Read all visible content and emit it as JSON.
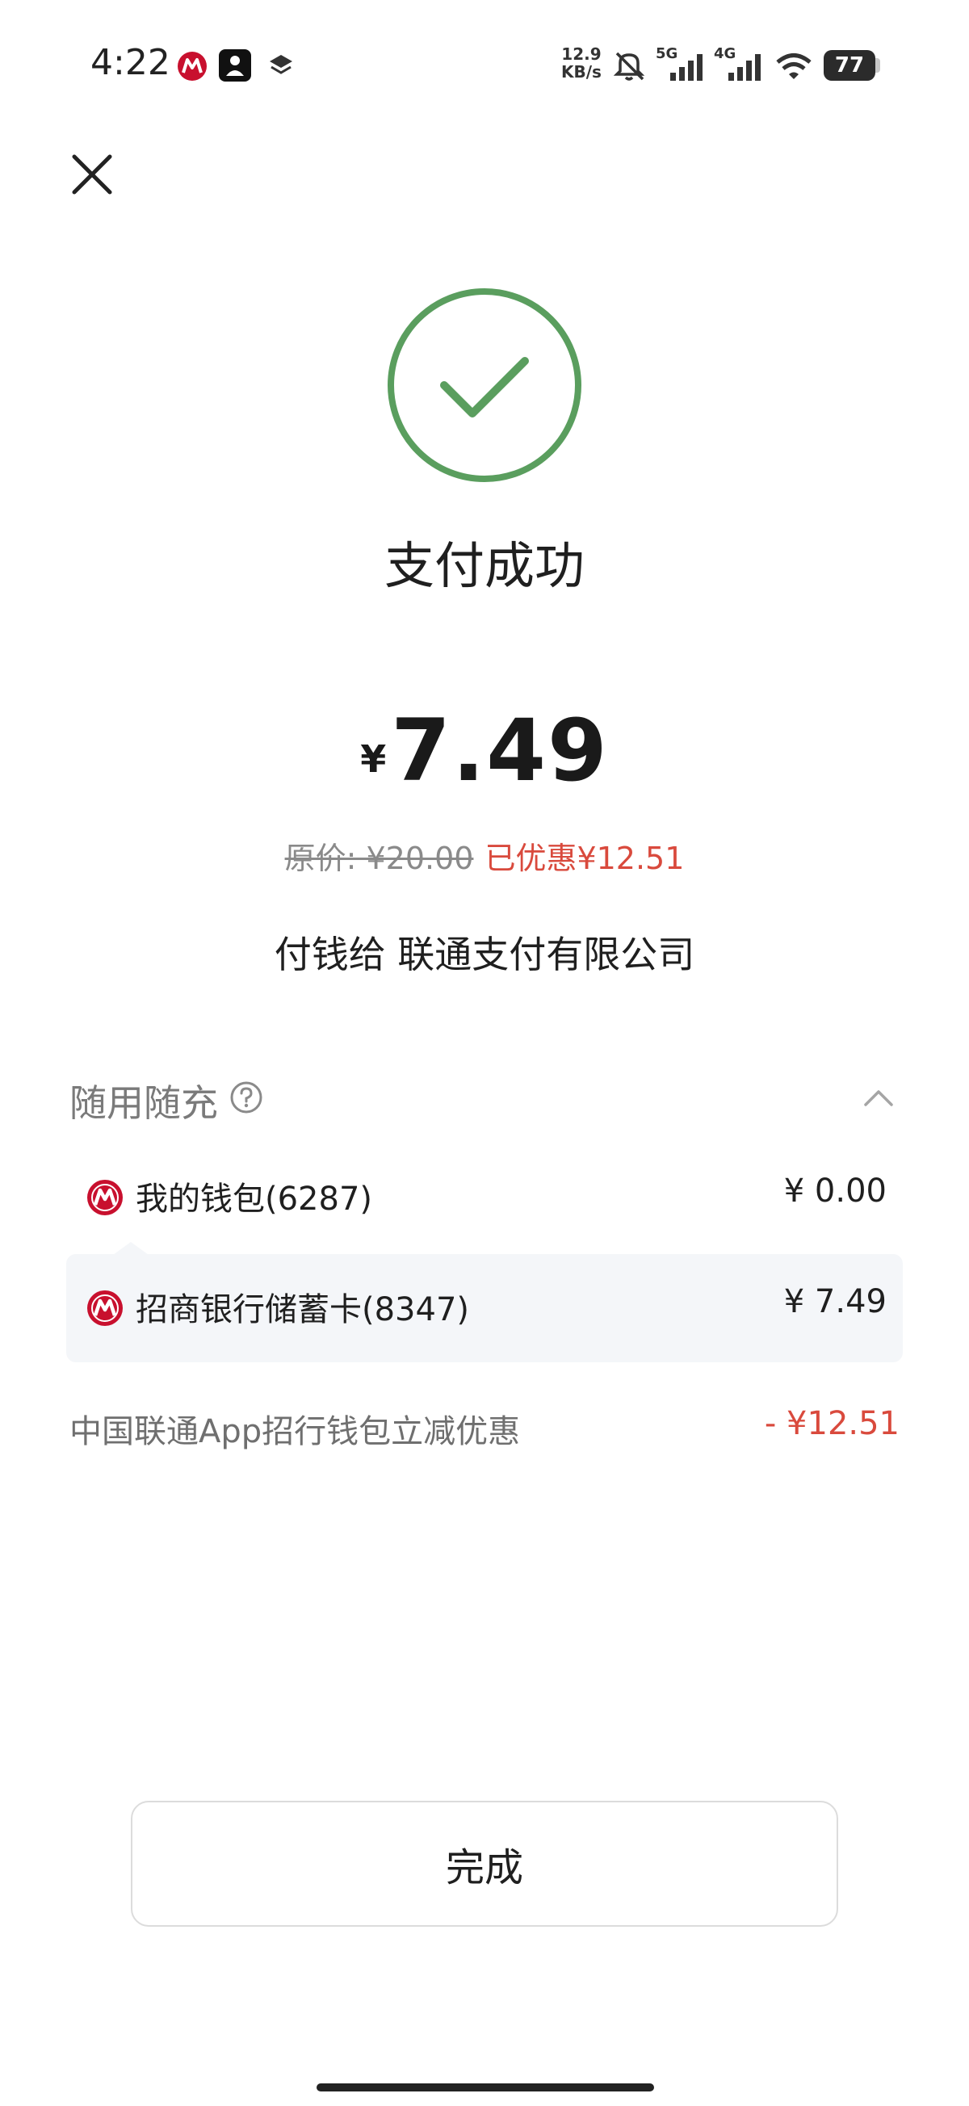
{
  "status_bar": {
    "time": "4:22",
    "net_speed_value": "12.9",
    "net_speed_unit": "KB/s",
    "signal_1": "5G",
    "signal_2": "4G",
    "battery": "77"
  },
  "result": {
    "title": "支付成功",
    "currency": "¥",
    "amount": "7.49",
    "original_price": "原价: ¥20.00",
    "saved": "已优惠¥12.51",
    "payee": "付钱给 联通支付有限公司"
  },
  "payment_section": {
    "title": "随用随充",
    "methods": [
      {
        "label": "我的钱包(6287)",
        "amount": "¥ 0.00"
      },
      {
        "label": "招商银行储蓄卡(8347)",
        "amount": "¥ 7.49"
      }
    ],
    "discount": {
      "label": "中国联通App招行钱包立减优惠",
      "amount": "- ¥12.51"
    }
  },
  "actions": {
    "done": "完成"
  },
  "colors": {
    "success_green": "#5a9e5e",
    "discount_red": "#d94a3d",
    "cmb_red": "#c8102e"
  }
}
